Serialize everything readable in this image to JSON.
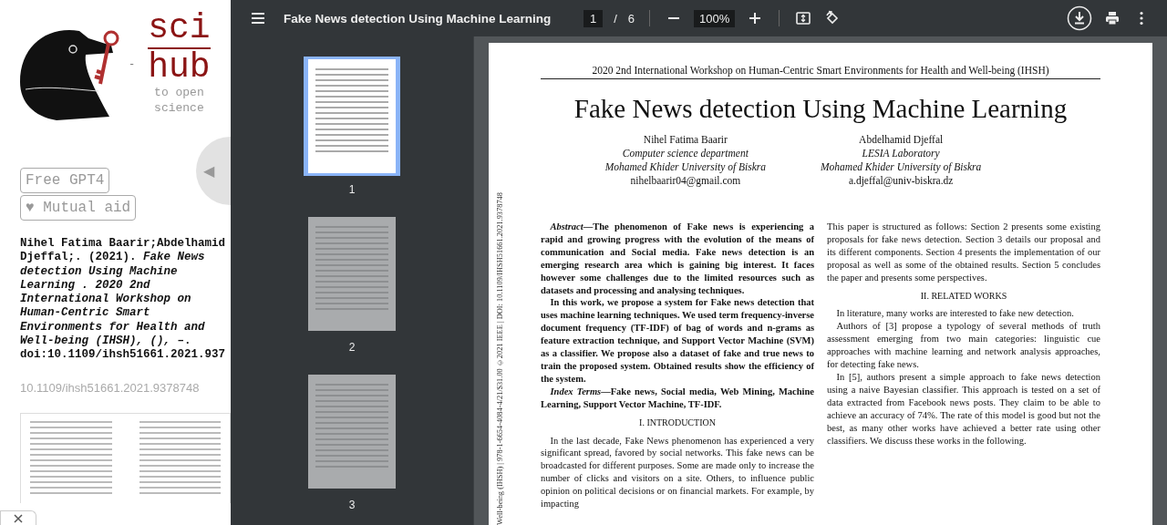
{
  "sidebar": {
    "logo": {
      "title_top": "sci",
      "separator": "-",
      "title_bottom": "hub",
      "tagline": [
        "to open",
        "science"
      ]
    },
    "buttons": [
      {
        "label": "Free GPT4"
      },
      {
        "label": "♥ Mutual aid"
      }
    ],
    "collapse_button": {
      "glyph": "◀"
    },
    "citation": "Nihel Fatima Baarir;Abdelhamid Djeffal;. (2021). *Fake News detection Using Machine Learning . 2020 2nd International Workshop on Human-Centric Smart Environments for Health and Well-being (IHSH), (),* –. doi:10.1109/ihsh51661.2021.937",
    "doi_link": "10.1109/ihsh51661.2021.9378748"
  },
  "viewer": {
    "title": "Fake News detection Using Machine Learning",
    "page_input": "1",
    "page_separator": "/",
    "page_count": "6",
    "zoom": "100%"
  },
  "thumbnails": [
    {
      "label": "1",
      "selected": true
    },
    {
      "label": "2",
      "selected": false
    },
    {
      "label": "3",
      "selected": false
    }
  ],
  "page": {
    "running_header": "2020 2nd International Workshop on Human-Centric Smart Environments for Health and Well-being (IHSH)",
    "title": "Fake News detection Using Machine Learning",
    "authors": [
      {
        "name": "Nihel Fatima Baarir",
        "department": "Computer science department",
        "university": "Mohamed Khider University of Biskra",
        "email": "nihelbaarir04@gmail.com"
      },
      {
        "name": "Abdelhamid Djeffal",
        "department": "LESIA Laboratory",
        "university": "Mohamed Khider University of Biskra",
        "email": "a.djeffal@univ-biskra.dz"
      }
    ],
    "side_note": "Well-being (IHSH) | 978-1-6654-4084-4/21/$31.00 ©2021 IEEE | DOI: 10.1109/IHSH51661.2021.9378748",
    "left_column": [
      {
        "kind": "abstract",
        "text": "*Abstract*—The phenomenon of Fake news is experiencing a rapid and growing progress with the evolution of the means of communication and Social media. Fake news detection is an emerging research area which is gaining big interest. It faces however some challenges due to the limited resources such as datasets and processing and analysing techniques."
      },
      {
        "kind": "abstract",
        "text": "In this work, we propose a system for Fake news detection that uses machine learning techniques. We used term frequency-inverse document frequency (TF-IDF) of bag of words and n-grams as feature extraction technique, and Support Vector Machine (SVM) as a classifier. We propose also a dataset of fake and true news to train the proposed system. Obtained results show the efficiency of the system."
      },
      {
        "kind": "abstract",
        "text": "*Index Terms*—Fake news, Social media, Web Mining, Machine Learning, Support Vector Machine, TF-IDF."
      },
      {
        "kind": "heading",
        "text": "I. INTRODUCTION"
      },
      {
        "kind": "paragraph",
        "text": "In the last decade, Fake News phenomenon has experienced a very significant spread, favored by social networks. This fake news can be broadcasted for different purposes. Some are made only to increase the number of clicks and visitors on a site. Others, to influence public opinion on political decisions or on financial markets. For example, by impacting"
      }
    ],
    "right_column": [
      {
        "kind": "continuation",
        "text": "This paper is structured as follows: Section 2 presents some existing proposals for fake news detection. Section 3 details our proposal and its different components. Section 4 presents the implementation of our proposal as well as some of the obtained results. Section 5 concludes the paper and presents some perspectives."
      },
      {
        "kind": "heading",
        "text": "II. RELATED WORKS"
      },
      {
        "kind": "paragraph",
        "text": "In literature, many works are interested to fake new detection."
      },
      {
        "kind": "paragraph",
        "text": "Authors of [3] propose a typology of several methods of truth assessment emerging from two main categories: linguistic cue approaches with machine learning and network analysis approaches, for detecting fake news."
      },
      {
        "kind": "paragraph",
        "text": "In [5], authors present a simple approach to fake news detection using a naive Bayesian classifier. This approach is tested on a set of data extracted from Facebook news posts. They claim to be able to achieve an accuracy of 74%. The rate of this model is good but not the best, as many other works have achieved a better rate using other classifiers. We discuss these works in the following."
      }
    ]
  }
}
